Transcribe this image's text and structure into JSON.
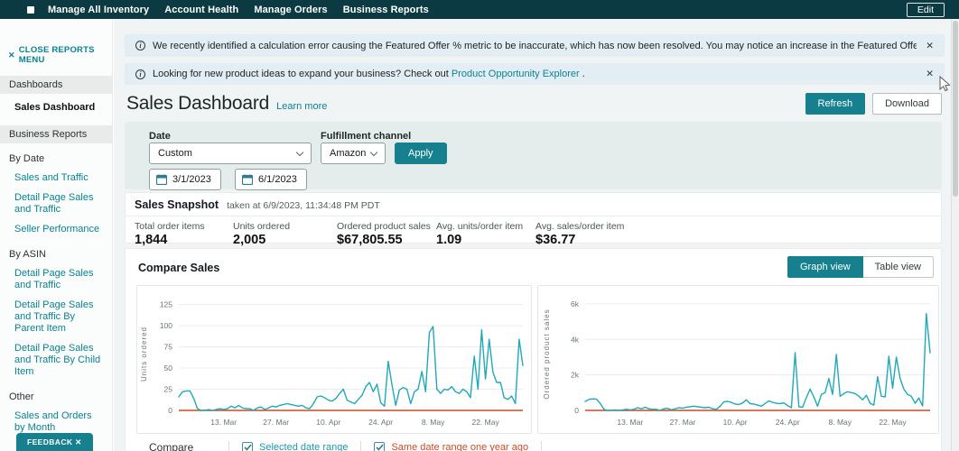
{
  "topbar": {
    "nav": [
      "Manage All Inventory",
      "Account Health",
      "Manage Orders",
      "Business Reports"
    ],
    "edit": "Edit"
  },
  "banners": {
    "first": {
      "text": "We recently identified a calculation error causing the Featured Offer % metric to be inaccurate, which has now been resolved. You may notice an increase in the Featured Offer % metric for some ASINs as a result of this fix."
    },
    "second": {
      "prefix": "Looking for new product ideas to expand your business? Check out ",
      "link": "Product Opportunity Explorer",
      "suffix": " ."
    }
  },
  "sidebar": {
    "close": "CLOSE REPORTS MENU",
    "dashboards_header": "Dashboards",
    "dashboards_active": "Sales Dashboard",
    "reports_header": "Business Reports",
    "groups": [
      {
        "label": "By Date",
        "links": [
          "Sales and Traffic",
          "Detail Page Sales and Traffic",
          "Seller Performance"
        ]
      },
      {
        "label": "By ASIN",
        "links": [
          "Detail Page Sales and Traffic",
          "Detail Page Sales and Traffic By Parent Item",
          "Detail Page Sales and Traffic By Child Item"
        ]
      },
      {
        "label": "Other",
        "links": [
          "Sales and Orders by Month"
        ]
      }
    ],
    "feedback": "FEEDBACK ✕"
  },
  "header": {
    "title": "Sales Dashboard",
    "learn_more": "Learn more",
    "refresh": "Refresh",
    "download": "Download"
  },
  "filters": {
    "date_label": "Date",
    "date_value": "Custom",
    "date_from": "3/1/2023",
    "date_to": "6/1/2023",
    "channel_label": "Fulfillment channel",
    "channel_value": "Amazon",
    "apply": "Apply"
  },
  "snapshot": {
    "title": "Sales Snapshot",
    "taken": "taken at 6/9/2023, 11:34:48 PM PDT",
    "metrics": [
      {
        "label": "Total order items",
        "value": "1,844"
      },
      {
        "label": "Units ordered",
        "value": "2,005"
      },
      {
        "label": "Ordered product sales",
        "value": "$67,805.55"
      },
      {
        "label": "Avg. units/order item",
        "value": "1.09"
      },
      {
        "label": "Avg. sales/order item",
        "value": "$36.77"
      }
    ]
  },
  "compare": {
    "title": "Compare Sales",
    "graph_view": "Graph view",
    "table_view": "Table view",
    "label": "Compare",
    "legend": [
      {
        "label": "Selected date range",
        "checked": true,
        "color": "#1b9aad"
      },
      {
        "label": "Same date range one year ago",
        "checked": true,
        "color": "#cc4b24"
      }
    ]
  },
  "chart_data": [
    {
      "type": "line",
      "ylabel": "Units ordered",
      "x_start": "3/1/2023",
      "x_end": "6/1/2023",
      "x_tick_labels": [
        "13. Mar",
        "27. Mar",
        "10. Apr",
        "24. Apr",
        "8. May",
        "22. May"
      ],
      "x_tick_indices": [
        12,
        26,
        40,
        54,
        68,
        82
      ],
      "y_ticks": [
        0,
        25,
        50,
        75,
        100,
        125
      ],
      "y_tick_labels": [
        "0",
        "25",
        "50",
        "75",
        "100",
        "125"
      ],
      "ylim": [
        0,
        133
      ],
      "grid": true,
      "series": [
        {
          "name": "Selected date range",
          "color": "#21a8ba",
          "values": [
            16,
            22,
            23,
            23,
            14,
            2,
            0,
            0,
            1,
            0,
            1,
            2,
            1,
            2,
            5,
            3,
            6,
            3,
            2,
            2,
            0,
            3,
            4,
            1,
            3,
            5,
            4,
            6,
            7,
            8,
            7,
            6,
            5,
            6,
            3,
            2,
            8,
            16,
            17,
            15,
            12,
            11,
            14,
            20,
            25,
            12,
            10,
            8,
            13,
            18,
            28,
            33,
            22,
            31,
            9,
            5,
            58,
            30,
            6,
            24,
            27,
            25,
            8,
            22,
            25,
            46,
            22,
            92,
            99,
            25,
            20,
            25,
            24,
            28,
            22,
            20,
            25,
            22,
            15,
            64,
            25,
            95,
            37,
            84,
            45,
            33,
            33,
            15,
            13,
            17,
            8,
            84,
            53
          ]
        },
        {
          "name": "Same date range one year ago",
          "color": "#cc4b24",
          "values_constant": 0
        }
      ]
    },
    {
      "type": "line",
      "ylabel": "Ordered product sales",
      "x_start": "3/1/2023",
      "x_end": "6/1/2023",
      "x_tick_labels": [
        "13. Mar",
        "27. Mar",
        "10. Apr",
        "24. Apr",
        "8. May",
        "22. May"
      ],
      "x_tick_indices": [
        12,
        26,
        40,
        54,
        68,
        82
      ],
      "y_ticks": [
        0,
        2000,
        4000,
        6000
      ],
      "y_tick_labels": [
        "0",
        "2k",
        "4k",
        "6k"
      ],
      "ylim": [
        0,
        6350
      ],
      "grid": true,
      "series": [
        {
          "name": "Selected date range",
          "color": "#21a8ba",
          "values": [
            500,
            620,
            650,
            640,
            400,
            60,
            0,
            0,
            30,
            0,
            30,
            60,
            30,
            60,
            150,
            90,
            180,
            90,
            60,
            60,
            0,
            90,
            120,
            30,
            90,
            150,
            120,
            180,
            210,
            240,
            210,
            180,
            150,
            180,
            90,
            60,
            240,
            480,
            510,
            450,
            360,
            330,
            420,
            600,
            380,
            360,
            300,
            240,
            390,
            540,
            450,
            400,
            380,
            420,
            270,
            150,
            3250,
            200,
            180,
            720,
            1200,
            750,
            240,
            900,
            1000,
            1800,
            900,
            3150,
            800,
            950,
            1050,
            1000,
            950,
            800,
            600,
            850,
            400,
            300,
            1900,
            800,
            760,
            3050,
            1250,
            3000,
            1800,
            1200,
            900,
            800,
            400,
            700,
            250,
            5450,
            3250
          ]
        },
        {
          "name": "Same date range one year ago",
          "color": "#cc4b24",
          "values_constant": 0
        }
      ]
    }
  ]
}
